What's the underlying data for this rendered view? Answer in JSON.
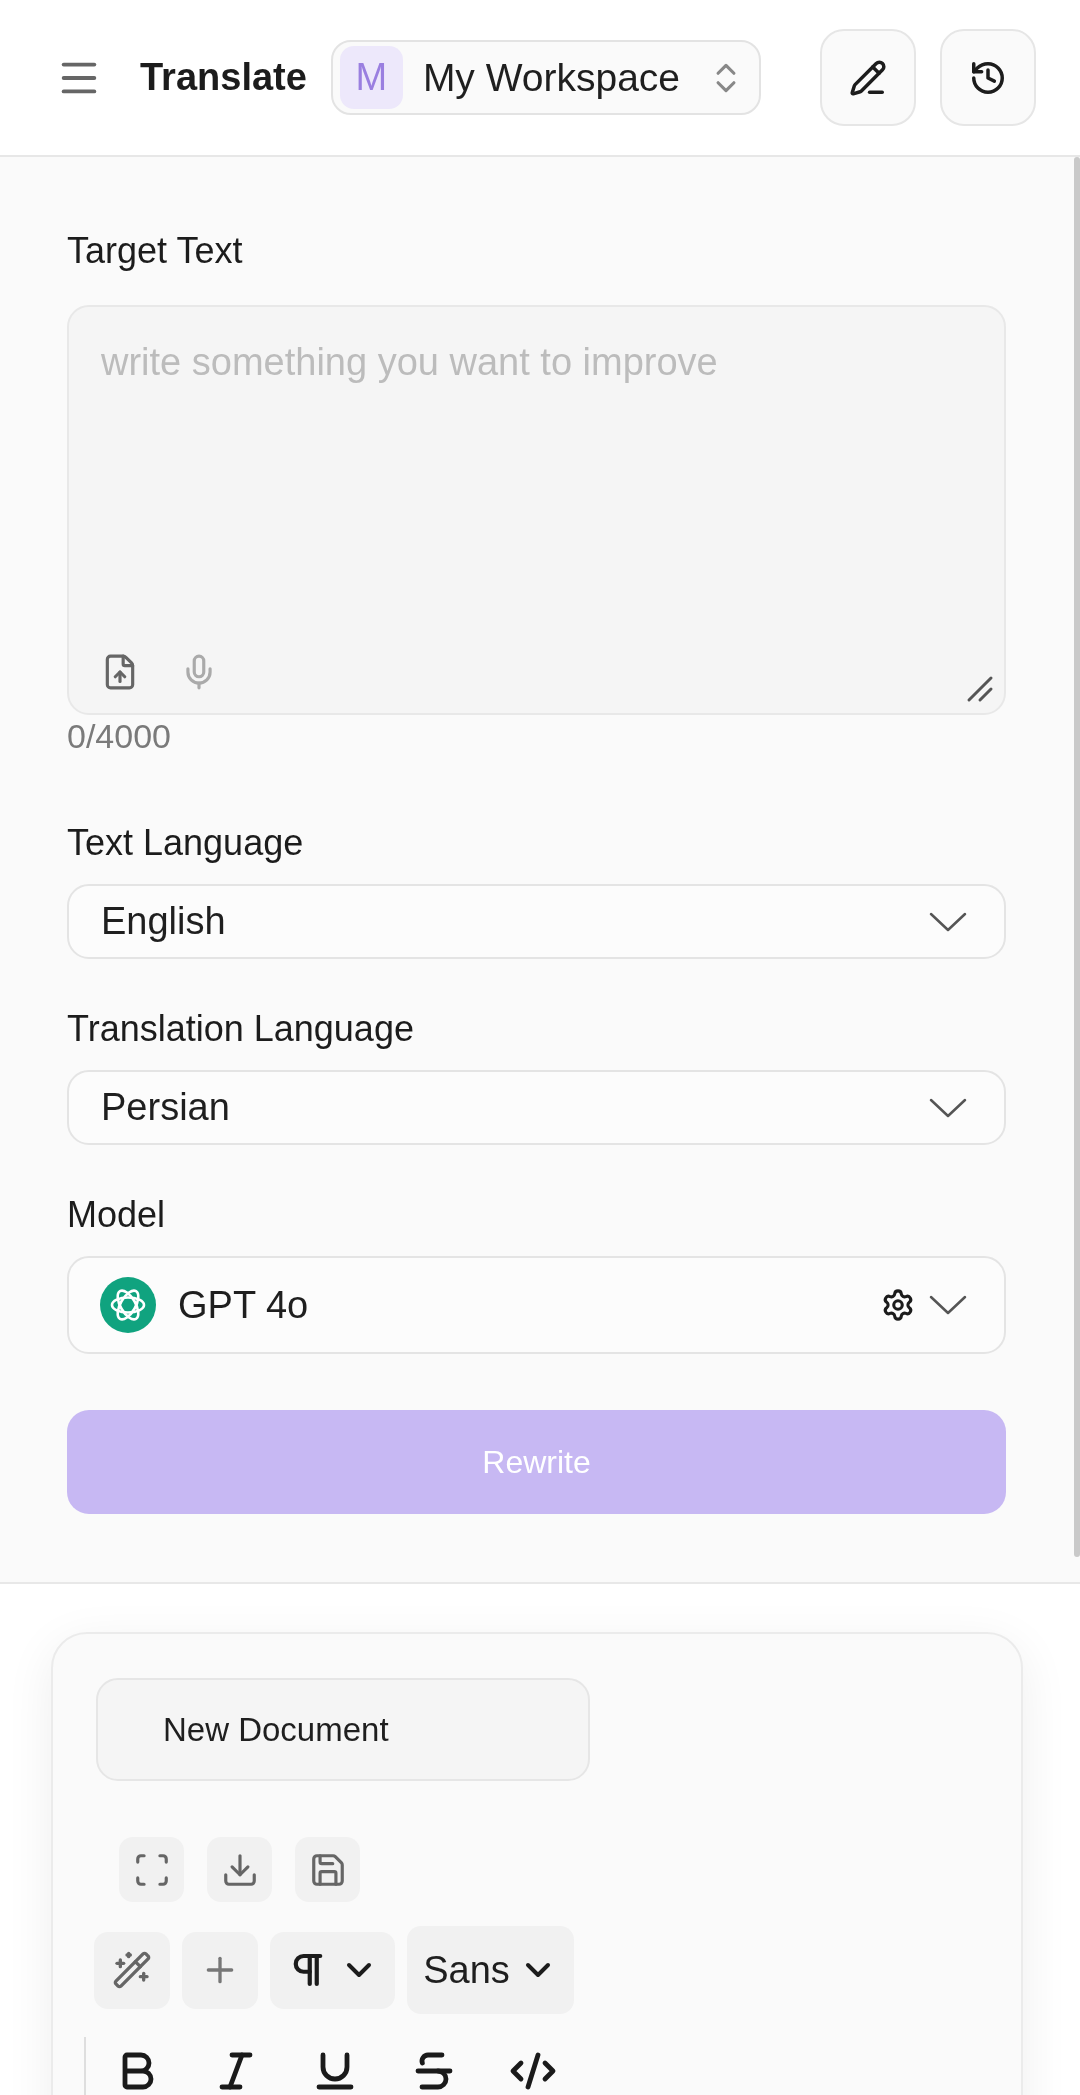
{
  "header": {
    "title": "Translate",
    "workspace": {
      "initial": "M",
      "name": "My Workspace"
    }
  },
  "target_text": {
    "label": "Target Text",
    "placeholder": "write something you want to improve",
    "counter": "0/4000"
  },
  "selects": [
    {
      "kind": "language",
      "label": "Text Language",
      "value": "English"
    },
    {
      "kind": "language",
      "label": "Translation Language",
      "value": "Persian"
    },
    {
      "kind": "model",
      "label": "Model",
      "value": "GPT 4o"
    }
  ],
  "rewrite_button": {
    "label": "Rewrite",
    "disabled": true
  },
  "editor": {
    "document_title": "New Document",
    "font_family": "Sans"
  }
}
